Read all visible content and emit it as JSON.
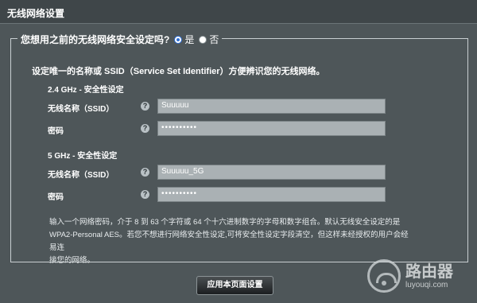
{
  "header": {
    "title": "无线网络设置"
  },
  "legend": {
    "question": "您想用之前的无线网络安全设定吗?",
    "option_yes": "是",
    "option_no": "否",
    "selected": "yes"
  },
  "intro": "设定唯一的名称或 SSID（Service Set Identifier）方便辨识您的无线网络。",
  "band_24": {
    "title": "2.4 GHz - 安全性设定",
    "ssid_label": "无线名称（SSID）",
    "ssid_value": "Suuuuu",
    "password_label": "密码",
    "password_value": "••••••••••"
  },
  "band_5": {
    "title": "5 GHz - 安全性设定",
    "ssid_label": "无线名称（SSID）",
    "ssid_value": "Suuuuu_5G",
    "password_label": "密码",
    "password_value": "••••••••••"
  },
  "help_glyph": "?",
  "note_line1": "输入一个网络密码，介于 8 到 63 个字符或 64 个十六进制数字的字母和数字组合。默认无线安全设定的是",
  "note_line2": "WPA2-Personal AES。若您不想进行网络安全性设定,可将安全性设定字段清空，但这样未经授权的用户会经易连",
  "note_line3": "接您的网络。",
  "apply_button": "应用本页面设置",
  "watermark": {
    "main": "路由器",
    "sub": "luyouqi.com"
  }
}
